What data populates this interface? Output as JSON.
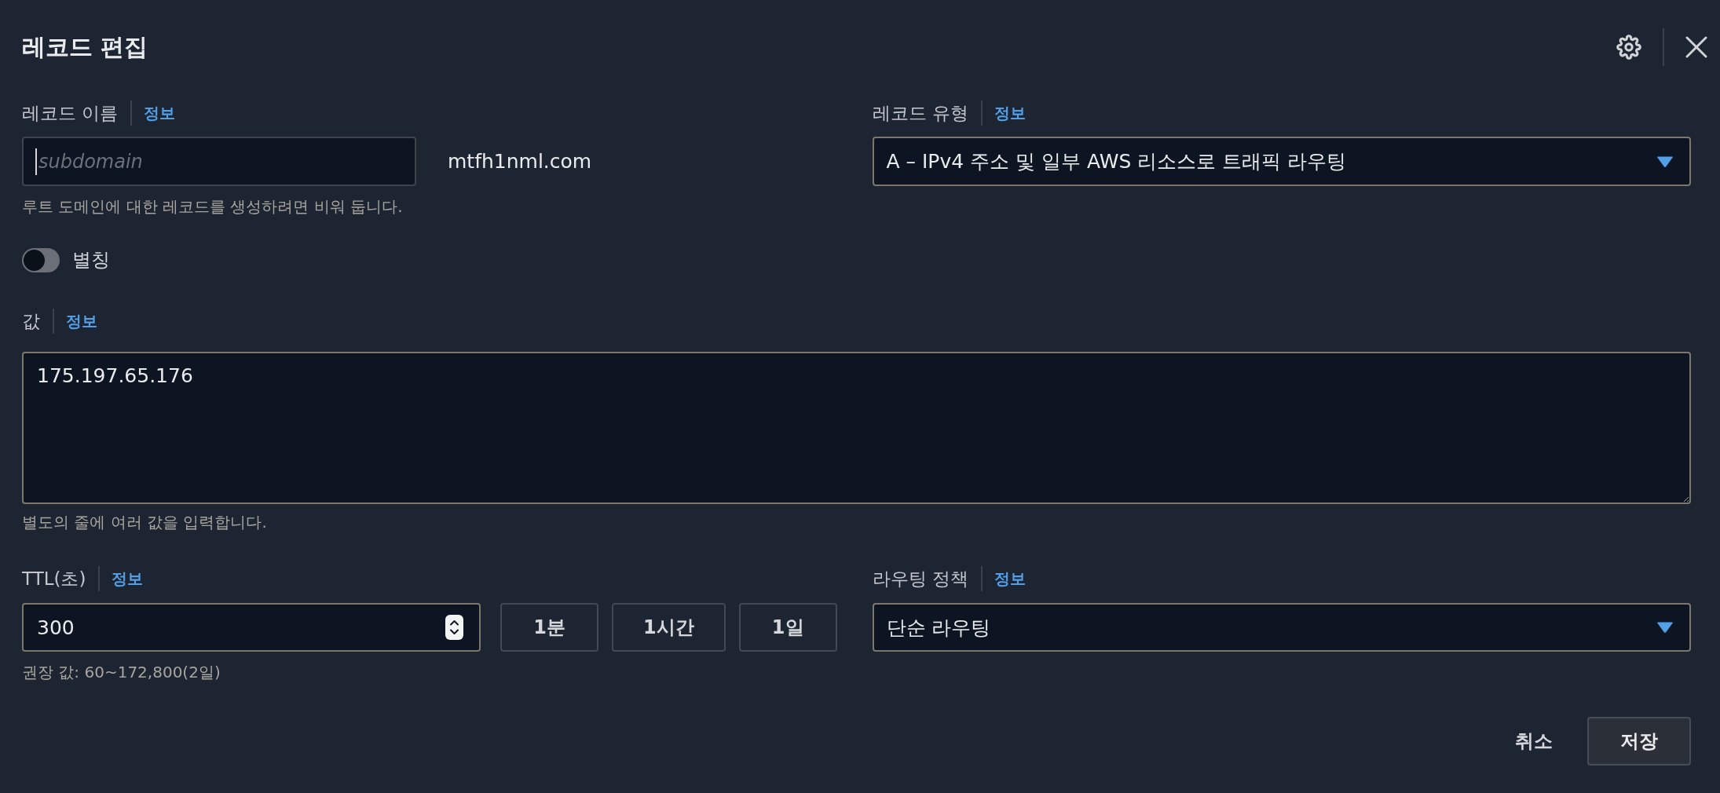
{
  "window": {
    "title": "레코드 편집"
  },
  "record_name": {
    "label": "레코드 이름",
    "info_link": "정보",
    "placeholder": "subdomain",
    "focused": true,
    "domain_suffix": "mtfh1nml.com",
    "hint": "루트 도메인에 대한 레코드를 생성하려면 비워 둡니다."
  },
  "record_type": {
    "label": "레코드 유형",
    "info_link": "정보",
    "value": "A – IPv4 주소 및 일부 AWS 리소스로 트래픽 라우팅"
  },
  "alias": {
    "label": "별칭",
    "on": false
  },
  "value": {
    "label": "값",
    "info_link": "정보",
    "value": "175.197.65.176",
    "hint": "별도의 줄에 여러 값을 입력합니다."
  },
  "ttl": {
    "label": "TTL(초)",
    "info_link": "정보",
    "value": "300",
    "presets": [
      "1분",
      "1시간",
      "1일"
    ],
    "hint": "권장 값: 60~172,800(2일)"
  },
  "routing_policy": {
    "label": "라우팅 정책",
    "info_link": "정보",
    "value": "단순 라우팅"
  },
  "footer_buttons": [
    {
      "label": "취소",
      "kind": "link"
    },
    {
      "label": "저장",
      "kind": "normal"
    }
  ]
}
